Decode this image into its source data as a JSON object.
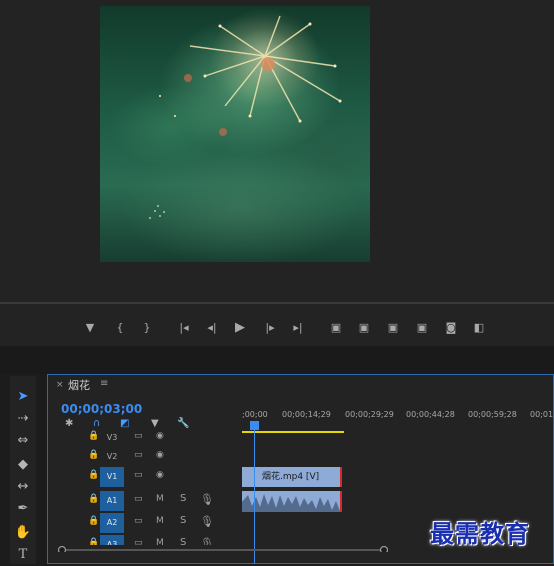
{
  "timeline": {
    "tab_title": "烟花",
    "tab_close": "×",
    "tab_menu": "≡",
    "timecode": "00;00;03;00",
    "ruler_ticks": [
      ";00;00",
      "00;00;14;29",
      "00;00;29;29",
      "00;00;44;28",
      "00;00;59;28",
      "00;01"
    ],
    "tracks": [
      {
        "name": "V3",
        "kind": "video"
      },
      {
        "name": "V2",
        "kind": "video"
      },
      {
        "name": "V1",
        "kind": "video",
        "selected": true
      },
      {
        "name": "A1",
        "kind": "audio",
        "selected": true
      },
      {
        "name": "A2",
        "kind": "audio",
        "selected": true
      },
      {
        "name": "A3",
        "kind": "audio",
        "selected": true
      }
    ],
    "mute_label": "M",
    "solo_label": "S",
    "video_clip_label": "烟花.mp4 [V]"
  },
  "watermark": "最需教育",
  "colors": {
    "accent": "#3b8cf0",
    "clip": "#8eabd8",
    "clip_end": "#d62a2a",
    "work_area": "#e6d800"
  }
}
